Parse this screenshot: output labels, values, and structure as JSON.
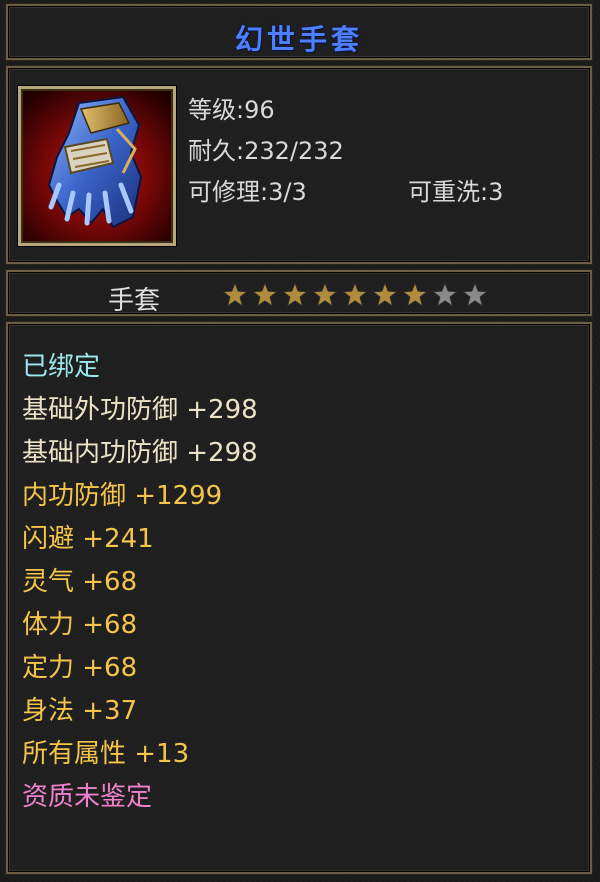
{
  "item": {
    "name": "幻世手套",
    "level_line": "等级:96",
    "durability_line": "耐久:232/232",
    "repairable_line": "可修理:3/3",
    "rewashable_line": "可重洗:3",
    "type": "手套",
    "icon": "gauntlet-icon",
    "stars_total": 9,
    "stars_filled": 7
  },
  "colors": {
    "title": "#4d7fff",
    "info_text": "#d9d9d9",
    "bound": "#9ee7ee",
    "base_defense": "#ece3c6",
    "bonus_attr": "#f5c44a",
    "unidentified": "#ef82cf",
    "star_filled": "#b08c3c",
    "star_empty": "#8a8a8a"
  },
  "attributes": [
    {
      "text": "已绑定",
      "kind": "bound"
    },
    {
      "text": "基础外功防御 +298",
      "kind": "base_defense"
    },
    {
      "text": "基础内功防御 +298",
      "kind": "base_defense"
    },
    {
      "text": "内功防御 +1299",
      "kind": "bonus_attr"
    },
    {
      "text": "闪避 +241",
      "kind": "bonus_attr"
    },
    {
      "text": "灵气 +68",
      "kind": "bonus_attr"
    },
    {
      "text": "体力 +68",
      "kind": "bonus_attr"
    },
    {
      "text": "定力 +68",
      "kind": "bonus_attr"
    },
    {
      "text": "身法 +37",
      "kind": "bonus_attr"
    },
    {
      "text": "所有属性 +13",
      "kind": "bonus_attr"
    },
    {
      "text": "资质未鉴定",
      "kind": "unidentified"
    }
  ]
}
